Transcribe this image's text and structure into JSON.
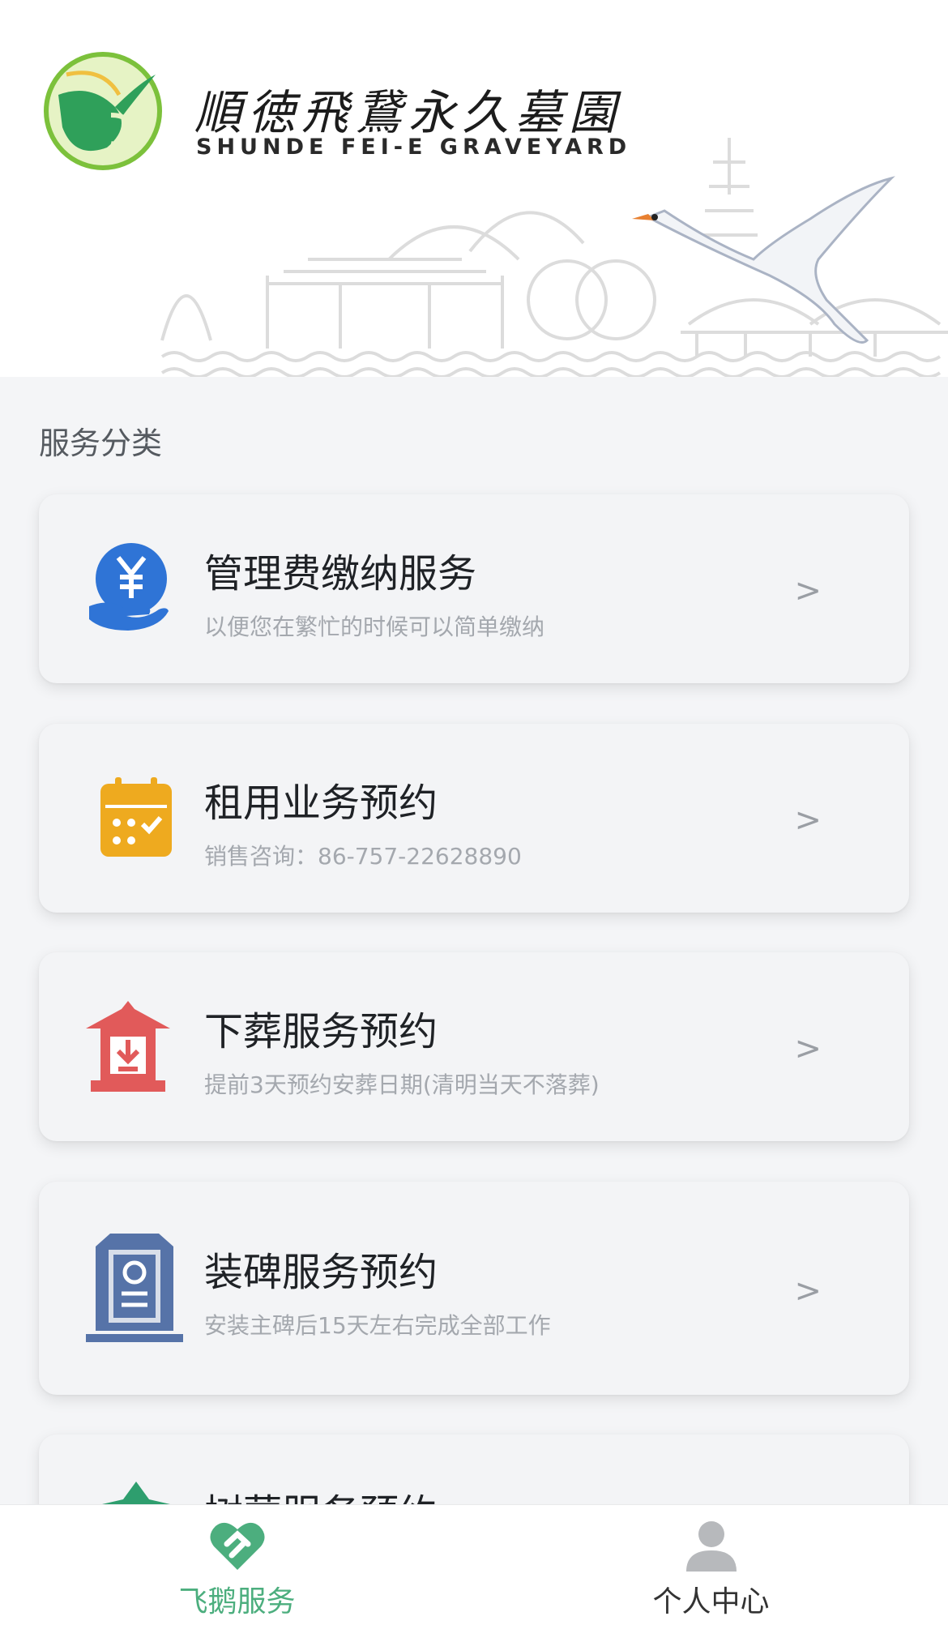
{
  "header": {
    "brand_cn": "順徳飛鵞永久墓園",
    "brand_en": "SHUNDE FEI-E GRAVEYARD"
  },
  "section_title": "服务分类",
  "services": [
    {
      "title": "管理费缴纳服务",
      "subtitle": "以便您在繁忙的时候可以简单缴纳",
      "chevron": ">",
      "icon": "yen-hand-icon",
      "color": "#2f74d6"
    },
    {
      "title": "租用业务预约",
      "subtitle": "销售咨询：86-757-22628890",
      "chevron": ">",
      "icon": "calendar-check-icon",
      "color": "#eeaa1f"
    },
    {
      "title": "下葬服务预约",
      "subtitle": "提前3天预约安葬日期(清明当天不落葬)",
      "chevron": ">",
      "icon": "pavilion-download-icon",
      "color": "#e15a5a"
    },
    {
      "title": "装碑服务预约",
      "subtitle": "安装主碑后15天左右完成全部工作",
      "chevron": ">",
      "icon": "tombstone-icon",
      "color": "#5673a8"
    },
    {
      "title": "树葬服务预约",
      "subtitle": "",
      "chevron": "",
      "icon": "tree-icon",
      "color": "#2e9e6e"
    }
  ],
  "tabbar": {
    "tabs": [
      {
        "label": "飞鹅服务",
        "active": true,
        "color": "#4cae7e"
      },
      {
        "label": "个人中心",
        "active": false,
        "color": "#333333"
      }
    ]
  }
}
